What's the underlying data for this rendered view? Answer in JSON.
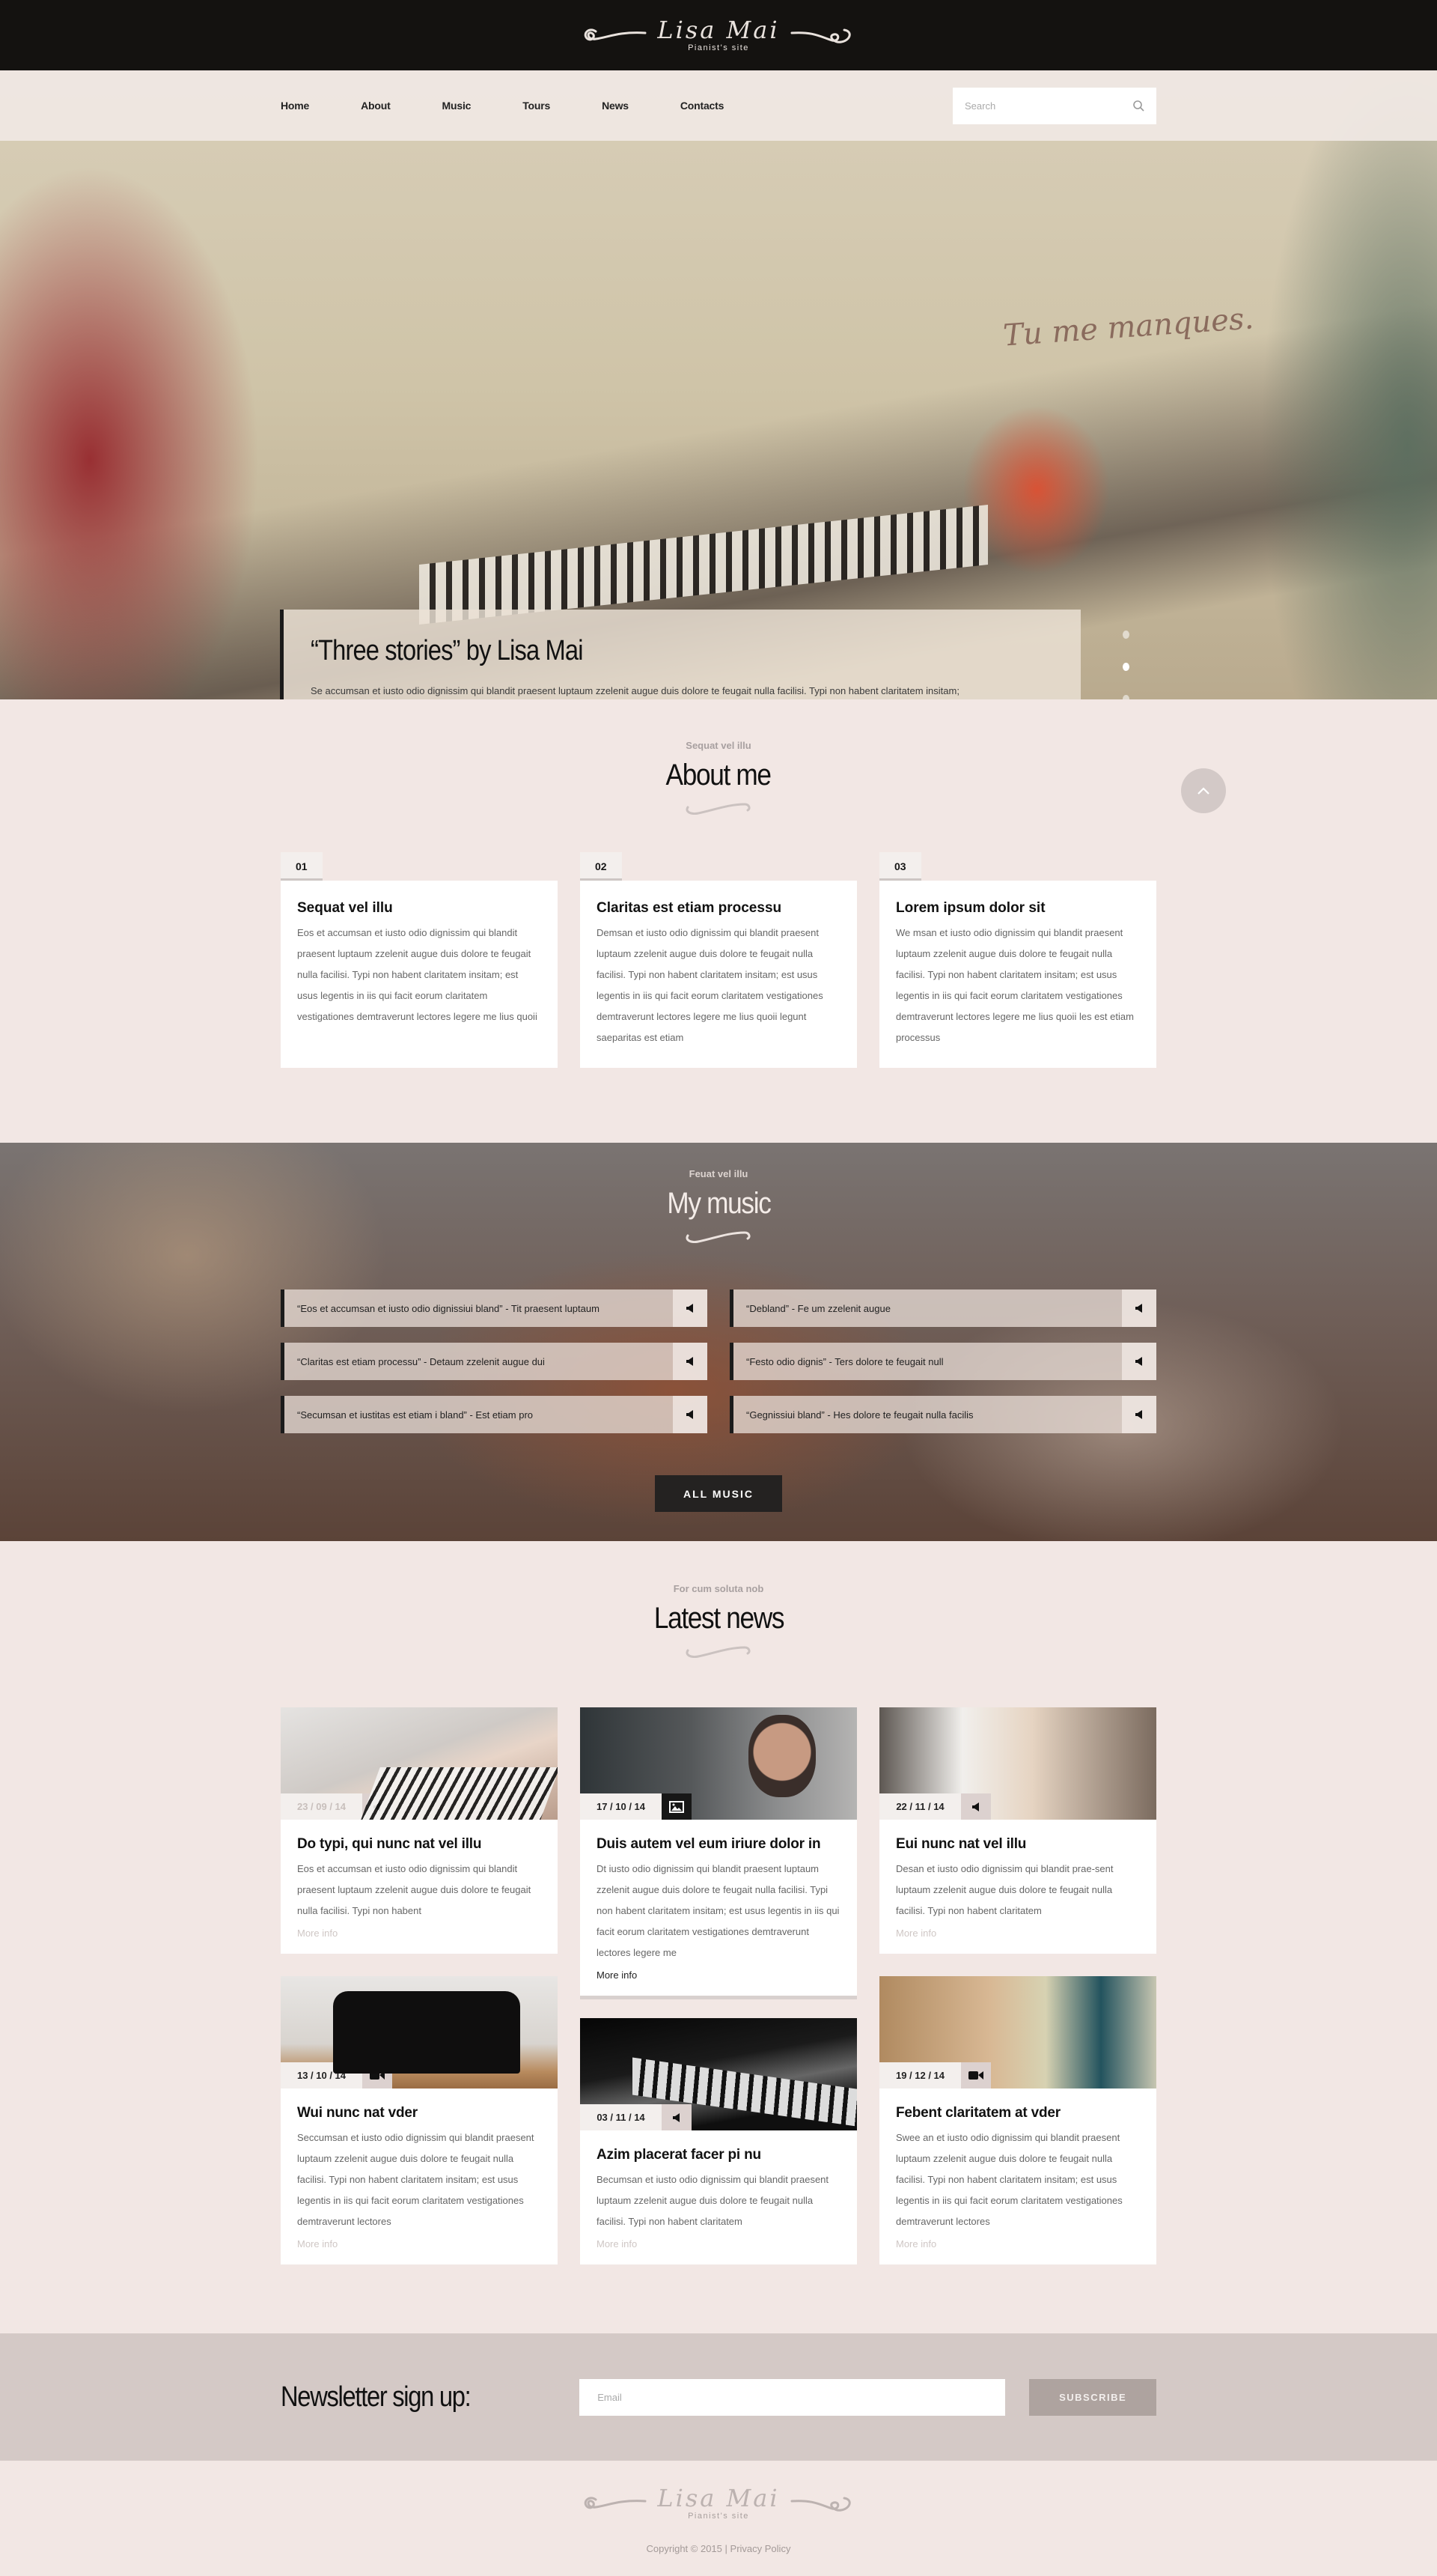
{
  "brand": {
    "name": "Lisa Mai",
    "tagline": "Pianist's site"
  },
  "nav": {
    "items": [
      {
        "label": "Home",
        "active": true
      },
      {
        "label": "About",
        "active": false
      },
      {
        "label": "Music",
        "active": false
      },
      {
        "label": "Tours",
        "active": false
      },
      {
        "label": "News",
        "active": false
      },
      {
        "label": "Contacts",
        "active": false
      }
    ],
    "search": {
      "placeholder": "Search",
      "value": "",
      "icon": "search-icon"
    }
  },
  "hero": {
    "title": "“Three stories” by Lisa Mai",
    "text": "Se accumsan et iusto odio dignissim qui blandit praesent luptaum zzelenit augue duis dolore te feugait nulla facilisi. Typi non habent claritatem insitam;",
    "slides": 3,
    "active_slide": 2
  },
  "about": {
    "subtitle": "Sequat vel illu",
    "title": "About me",
    "scroll_top_icon": "chevron-up-icon",
    "cards": [
      {
        "num": "01",
        "title": "Sequat vel illu",
        "text": "Eos et accumsan et iusto odio dignissim qui blandit praesent luptaum zzelenit augue duis dolore te feugait nulla facilisi. Typi non habent claritatem insitam; est usus legentis in iis qui facit eorum claritatem vestigationes demtraverunt lectores legere me lius quoii"
      },
      {
        "num": "02",
        "title": "Claritas est etiam processu",
        "text": "Demsan et iusto odio dignissim qui blandit praesent luptaum zzelenit augue duis dolore te feugait nulla facilisi. Typi non habent claritatem insitam; est usus legentis in iis qui facit eorum claritatem vestigationes demtraverunt lectores legere me lius quoii legunt saeparitas est etiam"
      },
      {
        "num": "03",
        "title": "Lorem ipsum dolor sit",
        "text": "We msan et iusto odio dignissim qui blandit praesent luptaum zzelenit augue duis dolore te feugait nulla facilisi. Typi non habent claritatem insitam; est usus legentis in iis qui facit eorum claritatem vestigationes demtraverunt lectores legere me lius quoii les est etiam processus"
      }
    ]
  },
  "music": {
    "subtitle": "Feuat vel illu",
    "title": "My music",
    "tracks": [
      {
        "title": "“Eos et accumsan et iusto odio dignissiui bland” - Tit praesent luptaum"
      },
      {
        "title": "“Debland” - Fe um zzelenit augue"
      },
      {
        "title": "“Claritas est etiam processu” - Detaum zzelenit augue dui"
      },
      {
        "title": "“Festo odio dignis” - Ters dolore te feugait null"
      },
      {
        "title": "“Secumsan et iustitas est etiam i bland” - Est etiam pro"
      },
      {
        "title": "“Gegnissiui bland” - Hes dolore te feugait nulla facilis"
      }
    ],
    "all_music_label": "ALL MUSIC"
  },
  "news": {
    "subtitle": "For cum soluta nob",
    "title": "Latest news",
    "columns": [
      [
        {
          "date": "23 / 09 / 14",
          "type": "audio",
          "title": "Do typi, qui nunc nat vel illu",
          "text": "Eos et accumsan et iusto odio dignissim qui blandit praesent luptaum zzelenit augue duis dolore te feugait nulla facilisi. Typi non habent",
          "more": "More info"
        },
        {
          "date": "13 / 10 / 14",
          "type": "video",
          "title": "Wui nunc nat vder",
          "text": "Seccumsan et iusto odio dignissim qui blandit praesent luptaum zzelenit augue duis dolore te feugait nulla facilisi. Typi non habent claritatem insitam; est usus legentis in iis qui facit eorum claritatem vestigationes demtraverunt lectores",
          "more": "More info"
        }
      ],
      [
        {
          "date": "17 / 10 / 14",
          "type": "image",
          "title": "Duis autem vel eum iriure dolor in",
          "text": "Dt iusto odio dignissim qui blandit praesent luptaum zzelenit augue duis dolore te feugait nulla facilisi. Typi non habent claritatem insitam; est usus legentis in iis qui facit eorum claritatem vestigationes demtraverunt lectores legere me",
          "more": "More info"
        },
        {
          "date": "03 / 11 / 14",
          "type": "audio",
          "title": "Azim placerat facer pi nu",
          "text": "Becumsan et iusto odio dignissim qui blandit praesent luptaum zzelenit augue duis dolore te feugait nulla facilisi. Typi non habent claritatem",
          "more": "More info"
        }
      ],
      [
        {
          "date": "22 / 11 / 14",
          "type": "audio",
          "title": "Eui nunc nat vel illu",
          "text": "Desan et iusto odio dignissim qui blandit prae-sent luptaum zzelenit augue duis dolore te feugait nulla facilisi. Typi non habent claritatem",
          "more": "More info"
        },
        {
          "date": "19 / 12 / 14",
          "type": "video",
          "title": "Febent claritatem at vder",
          "text": "Swee an et iusto odio dignissim qui blandit praesent luptaum zzelenit augue duis dolore te feugait nulla facilisi. Typi non habent claritatem insitam; est usus legentis in iis qui facit eorum claritatem vestigationes demtraverunt lectores",
          "more": "More info"
        }
      ]
    ]
  },
  "newsletter": {
    "title": "Newsletter sign up:",
    "email_placeholder": "Email",
    "email_value": "",
    "button_label": "SUBSCRIBE"
  },
  "footer": {
    "copyright": "Copyright © 2015",
    "separator": "|",
    "privacy_label": "Privacy Policy"
  },
  "colors": {
    "page_bg": "#f2e7e4",
    "header_bg": "#141210",
    "newsletter_bg": "#d4c9c6",
    "button_dark": "#242221",
    "subscribe_bg": "#aea39f"
  }
}
